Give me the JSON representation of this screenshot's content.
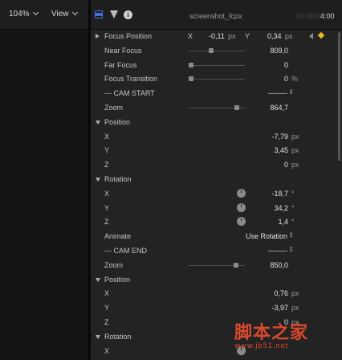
{
  "toolbar": {
    "zoom": "104%",
    "view": "View"
  },
  "inspector_header": {
    "filename": "screenshot_fcpx",
    "timecode_dim": "00:00:0",
    "timecode_bright": "4:00"
  },
  "focus": {
    "position": {
      "label": "Focus Position",
      "x_label": "X",
      "x_value": "-0,11",
      "x_unit": "px",
      "y_label": "Y",
      "y_value": "0,34",
      "y_unit": "px"
    },
    "near": {
      "label": "Near Focus",
      "value": "809,0",
      "slider": 0.35
    },
    "far": {
      "label": "Far Focus",
      "value": "0",
      "slider": 0.0
    },
    "transition": {
      "label": "Focus Transition",
      "value": "0",
      "unit": "%",
      "slider": 0.0
    }
  },
  "cam_start": {
    "label": "--- CAM START",
    "value": "--------",
    "zoom": {
      "label": "Zoom",
      "value": "864,7",
      "slider": 0.82
    },
    "position": {
      "label": "Position",
      "x": {
        "label": "X",
        "value": "-7,79",
        "unit": "px"
      },
      "y": {
        "label": "Y",
        "value": "3,45",
        "unit": "px"
      },
      "z": {
        "label": "Z",
        "value": "0",
        "unit": "px"
      }
    },
    "rotation": {
      "label": "Rotation",
      "x": {
        "label": "X",
        "value": "-18,7",
        "unit": "°"
      },
      "y": {
        "label": "Y",
        "value": "34,2",
        "unit": "°"
      },
      "z": {
        "label": "Z",
        "value": "1,4",
        "unit": "°"
      }
    },
    "animate": {
      "label": "Animate",
      "value": "Use Rotation"
    }
  },
  "cam_end": {
    "label": "--- CAM END",
    "value": "--------",
    "zoom": {
      "label": "Zoom",
      "value": "850,0",
      "slider": 0.8
    },
    "position": {
      "label": "Position",
      "x": {
        "label": "X",
        "value": "0,76",
        "unit": "px"
      },
      "y": {
        "label": "Y",
        "value": "-3,97",
        "unit": "px"
      },
      "z": {
        "label": "Z",
        "value": "0",
        "unit": "px"
      }
    },
    "rotation": {
      "label": "Rotation",
      "x": {
        "label": "X"
      }
    }
  },
  "watermark": {
    "main": "脚本之家",
    "url": "www.jb51.net"
  }
}
